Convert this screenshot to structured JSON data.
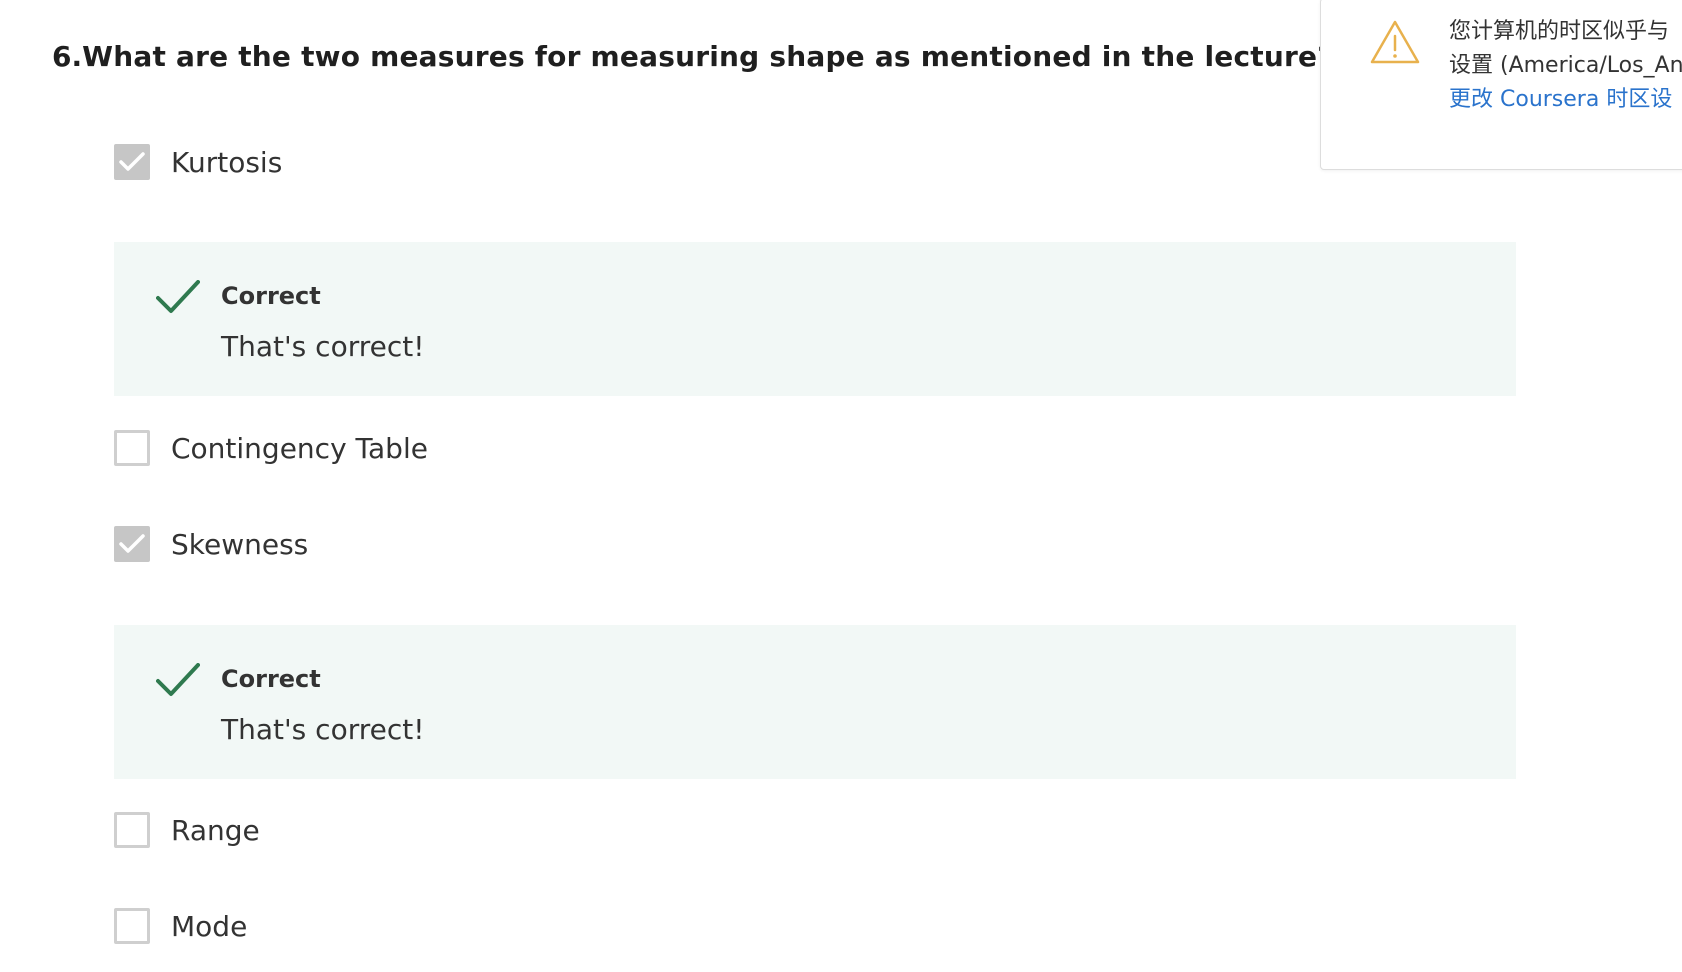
{
  "question": {
    "number": "6.",
    "text": "What are the two measures for measuring shape as mentioned in the lecture? Choose"
  },
  "options": [
    {
      "label": "Kurtosis",
      "checked": true
    },
    {
      "label": "Contingency Table",
      "checked": false
    },
    {
      "label": "Skewness",
      "checked": true
    },
    {
      "label": "Range",
      "checked": false
    },
    {
      "label": "Mode",
      "checked": false
    }
  ],
  "feedback": [
    {
      "title": "Correct",
      "text": "That's correct!"
    },
    {
      "title": "Correct",
      "text": "That's correct!"
    }
  ],
  "notification": {
    "line1": "您计算机的时区似乎与",
    "line2": "设置 (America/Los_An",
    "link": "更改 Coursera 时区设"
  },
  "colors": {
    "correct_green": "#2f7a4f",
    "feedback_bg": "#f2f8f6",
    "checkbox_checked": "#c6c6c6",
    "warning_amber": "#e8b14d",
    "link_blue": "#2a73cc"
  },
  "icons": {
    "checkbox_check": "check-icon",
    "feedback_check": "checkmark-icon",
    "warning": "warning-icon"
  }
}
